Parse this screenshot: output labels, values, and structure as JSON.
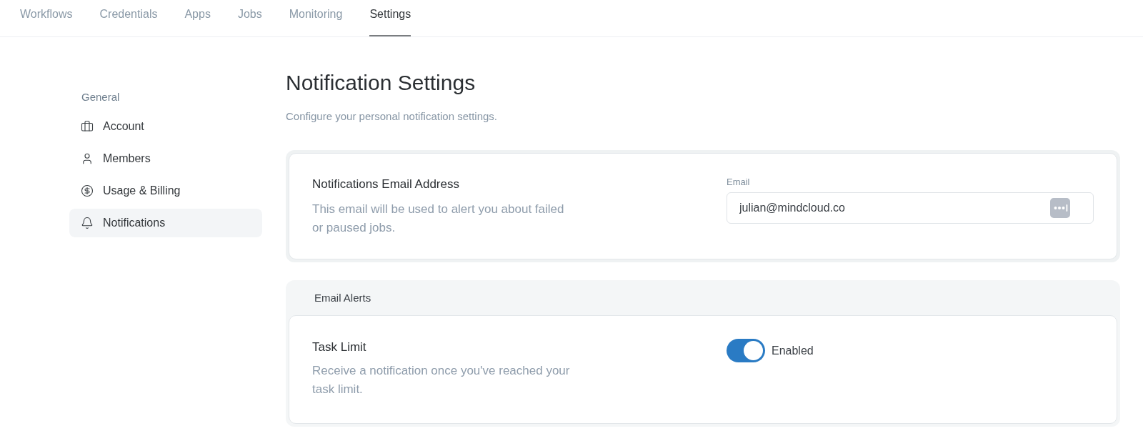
{
  "nav": {
    "tabs": [
      {
        "label": "Workflows",
        "selected": false
      },
      {
        "label": "Credentials",
        "selected": false
      },
      {
        "label": "Apps",
        "selected": false
      },
      {
        "label": "Jobs",
        "selected": false
      },
      {
        "label": "Monitoring",
        "selected": false
      },
      {
        "label": "Settings",
        "selected": true
      }
    ]
  },
  "sidebar": {
    "heading": "General",
    "items": [
      {
        "label": "Account",
        "selected": false
      },
      {
        "label": "Members",
        "selected": false
      },
      {
        "label": "Usage & Billing",
        "selected": false
      },
      {
        "label": "Notifications",
        "selected": true
      }
    ]
  },
  "page": {
    "title": "Notification Settings",
    "subtitle": "Configure your personal notification settings."
  },
  "email_card": {
    "title": "Notifications Email Address",
    "description": "This email will be used to alert you about failed or paused jobs.",
    "field": {
      "label": "Email",
      "value": "julian@mindcloud.co"
    }
  },
  "email_alerts": {
    "heading": "Email Alerts",
    "items": [
      {
        "title": "Task Limit",
        "description": "Receive a notification once you've reached your task limit.",
        "toggle": {
          "on": true,
          "label": "Enabled"
        }
      }
    ]
  }
}
